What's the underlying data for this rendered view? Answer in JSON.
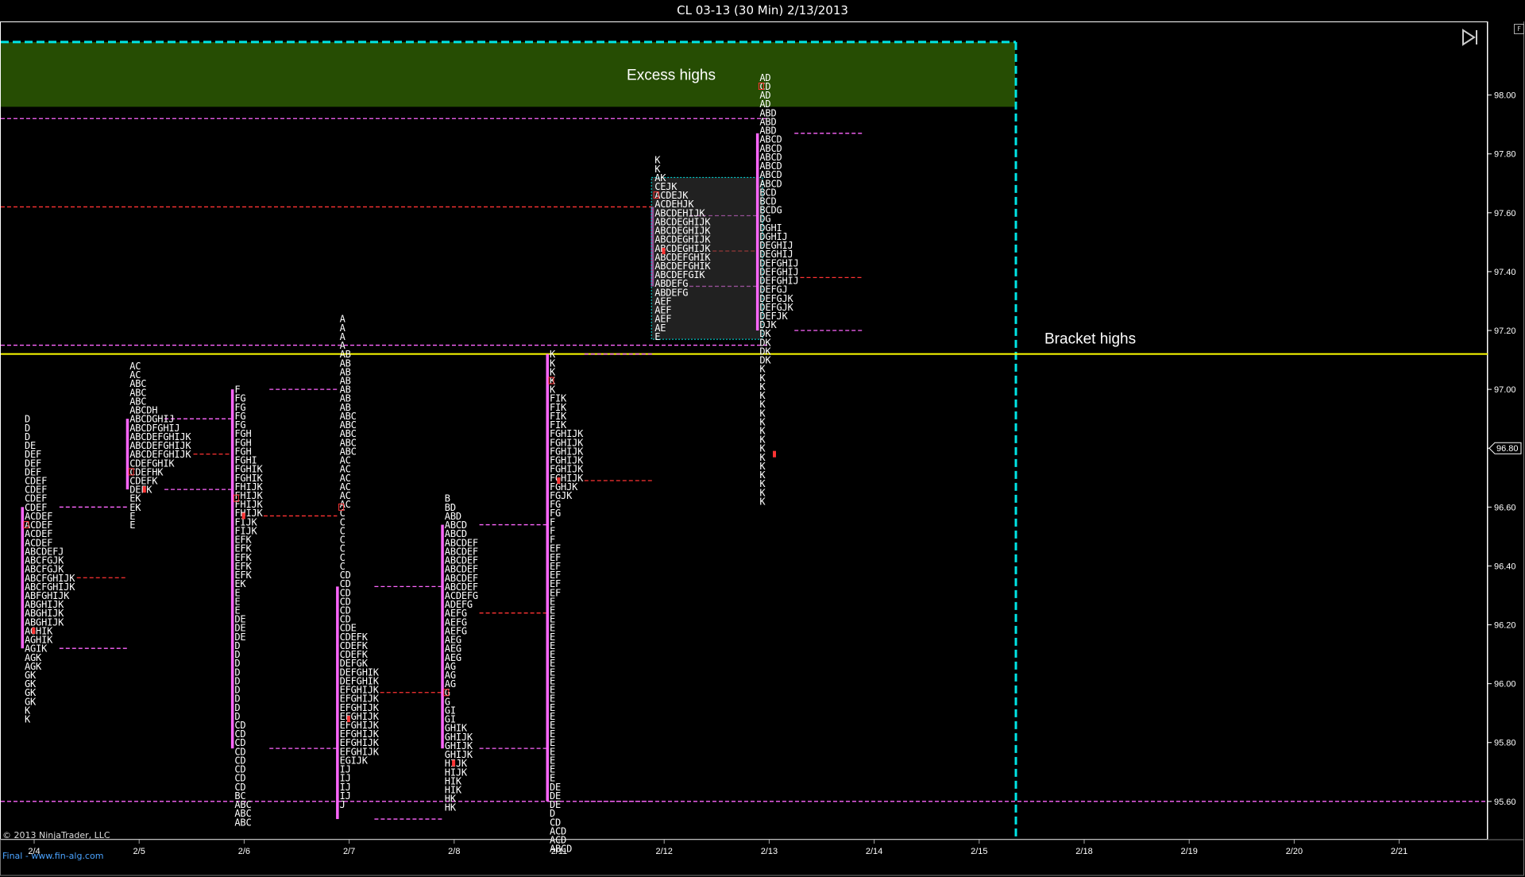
{
  "title": "CL 03-13 (30 Min)  2/13/2013",
  "copyright": "© 2013 NinjaTrader, LLC",
  "footer": "Final - www.fin-alg.com",
  "colors": {
    "background": "#000000",
    "axis": "#ffffff",
    "profile_text": "#ffffff",
    "open_marker": "#ff3333",
    "value_area_bar": "#ff66ff",
    "value_area_line": "#ff66ff",
    "poc_line": "#ff3333",
    "excess_zone": "#264d03",
    "bracket_line": "#ffff00",
    "session_divider": "#00e5e5",
    "footer_link": "#4aa3ff"
  },
  "chart_data": {
    "type": "market-profile",
    "x_labels": [
      "2/4",
      "2/5",
      "2/6",
      "2/7",
      "2/8",
      "2/11",
      "2/12",
      "2/13",
      "2/14",
      "2/15",
      "2/18",
      "2/19",
      "2/20",
      "2/21"
    ],
    "y_ticks": [
      "98.00",
      "97.80",
      "97.60",
      "97.40",
      "97.20",
      "97.00",
      "96.80",
      "96.60",
      "96.40",
      "96.20",
      "96.00",
      "95.80",
      "95.60"
    ],
    "ylim": [
      95.47,
      98.25
    ],
    "tick_size": 0.03,
    "current_price": "96.80",
    "annotations": {
      "excess_zone": {
        "label": "Excess highs",
        "y_low": 97.96,
        "y_high": 98.18
      },
      "bracket_line": {
        "label": "Bracket highs",
        "y": 97.12
      }
    },
    "profiles": [
      {
        "date": "2/4",
        "top": 96.9,
        "rows": [
          "D",
          "D",
          "D",
          "DE",
          "DEF",
          "DEF",
          "DEF",
          "CDEF",
          "CDEF",
          "CDEF",
          "CDEF",
          "ACDEF",
          "ACDEF",
          "ACDEF",
          "ACDEF",
          "ABCDEFJ",
          "ABCFGJK",
          "ABCFGJK",
          "ABCFGHIJK",
          "ABCFGHIJK",
          "ABFGHIJK",
          "ABGHIJK",
          "ABGHIJK",
          "ABGHIJK",
          "AGHIK",
          "AGHIK",
          "AGIK",
          "AGK",
          "AGK",
          "GK",
          "GK",
          "GK",
          "GK",
          "K",
          "K"
        ],
        "va_high": 96.6,
        "va_low": 96.12,
        "poc": 96.36,
        "vah_ext": 96.6,
        "val_ext": 96.12,
        "open_price": 96.54,
        "close_price": 96.18
      },
      {
        "date": "2/5",
        "top": 97.08,
        "rows": [
          "AC",
          "AC",
          "ABC",
          "ABC",
          "ABC",
          "ABCDH",
          "ABCDGHIJ",
          "ABCDFGHIJ",
          "ABCDEFGHIJK",
          "ABCDEFGHIJK",
          "ABCDEFGHIJK",
          "CDEFGHIK",
          "CDEFHK",
          "CDEFK",
          "DEFK",
          "EK",
          "EK",
          "E",
          "E"
        ],
        "va_high": 96.9,
        "va_low": 96.66,
        "poc": 96.78,
        "vah_ext": 96.9,
        "val_ext": 96.66,
        "open_price": 96.72,
        "close_price": 96.66
      },
      {
        "date": "2/6",
        "top": 97.0,
        "rows": [
          "F",
          "FG",
          "FG",
          "FG",
          "FG",
          "FGH",
          "FGH",
          "FGH",
          "FGHI",
          "FGHIK",
          "FGHIK",
          "FHIJK",
          "FHIJK",
          "FHIJK",
          "FHIJK",
          "FIJK",
          "FIJK",
          "EFK",
          "EFK",
          "EFK",
          "EFK",
          "EFK",
          "EK",
          "E",
          "E",
          "E",
          "DE",
          "DE",
          "DE",
          "D",
          "D",
          "D",
          "D",
          "D",
          "D",
          "D",
          "D",
          "D",
          "CD",
          "CD",
          "CD",
          "CD",
          "CD",
          "CD",
          "CD",
          "CD",
          "BC",
          "ABC",
          "ABC",
          "ABC"
        ],
        "va_high": 97.0,
        "va_low": 95.78,
        "poc": 96.57,
        "vah_ext": 97.0,
        "val_ext": 95.78,
        "open_price": 96.63,
        "close_price": 96.57
      },
      {
        "date": "2/7",
        "top": 97.24,
        "rows": [
          "A",
          "A",
          "A",
          "A",
          "AB",
          "AB",
          "AB",
          "AB",
          "AB",
          "AB",
          "AB",
          "ABC",
          "ABC",
          "ABC",
          "ABC",
          "ABC",
          "AC",
          "AC",
          "AC",
          "AC",
          "AC",
          "AC",
          "C",
          "C",
          "C",
          "C",
          "C",
          "C",
          "C",
          "CD",
          "CD",
          "CD",
          "CD",
          "CD",
          "CD",
          "CDE",
          "CDEFK",
          "CDEFK",
          "CDEFK",
          "DEFGK",
          "DEFGHIK",
          "DEFGHIK",
          "EFGHIJK",
          "EFGHIJK",
          "EFGHIJK",
          "EFGHIJK",
          "EFGHIJK",
          "EFGHIJK",
          "EFGHIJK",
          "EFGHIJK",
          "EGIJK",
          "IJ",
          "IJ",
          "IJ",
          "IJ",
          "J"
        ],
        "va_high": 96.33,
        "va_low": 95.54,
        "poc": 95.97,
        "vah_ext": 96.33,
        "val_ext": 95.54,
        "open_price": 96.6,
        "close_price": 95.88
      },
      {
        "date": "2/8",
        "top": 96.63,
        "rows": [
          "B",
          "BD",
          "ABD",
          "ABCD",
          "ABCD",
          "ABCDEF",
          "ABCDEF",
          "ABCDEF",
          "ABCDEF",
          "ABCDEF",
          "ABCDEF",
          "ACDEFG",
          "ADEFG",
          "AEFG",
          "AEFG",
          "AEFG",
          "AEG",
          "AEG",
          "AEG",
          "AG",
          "AG",
          "AG",
          "G",
          "G",
          "GI",
          "GI",
          "GHIK",
          "GHIJK",
          "GHIJK",
          "GHIJK",
          "HIJK",
          "HIJK",
          "HIK",
          "HIK",
          "HK",
          "HK"
        ],
        "va_high": 96.54,
        "va_low": 95.78,
        "poc": 96.24,
        "vah_ext": 96.54,
        "val_ext": 95.78,
        "open_price": 95.97,
        "close_price": 95.73
      },
      {
        "date": "2/11",
        "top": 97.12,
        "rows": [
          "K",
          "K",
          "K",
          "K",
          "K",
          "FIK",
          "FIK",
          "FIK",
          "FIK",
          "FGHIJK",
          "FGHIJK",
          "FGHIJK",
          "FGHIJK",
          "FGHIJK",
          "FGHIJK",
          "FGHJK",
          "FGJK",
          "FG",
          "FG",
          "F",
          "F",
          "F",
          "EF",
          "EF",
          "EF",
          "EF",
          "EF",
          "EF",
          "E",
          "E",
          "E",
          "E",
          "E",
          "E",
          "E",
          "E",
          "E",
          "E",
          "E",
          "E",
          "E",
          "E",
          "E",
          "E",
          "E",
          "E",
          "E",
          "E",
          "E",
          "DE",
          "DE",
          "DE",
          "D",
          "CD",
          "ACD",
          "ACD",
          "ABCD"
        ],
        "va_high": 97.12,
        "va_low": 95.6,
        "poc": 96.69,
        "vah_ext": 97.12,
        "val_ext": 95.6,
        "open_price": 97.03,
        "close_price": 96.69
      },
      {
        "date": "2/12",
        "top": 97.78,
        "rows": [
          "K",
          "K",
          "AK",
          "CEJK",
          "ACDEJK",
          "ACDEHJK",
          "ABCDEHIJK",
          "ABCDEGHIJK",
          "ABCDEGHIJK",
          "ABCDEGHIJK",
          "ABCDEGHIJK",
          "ABCDEFGHIK",
          "ABCDEFGHIK",
          "ABCDEFGIK",
          "ABDEFG",
          "ABDEFG",
          "AEF",
          "AEF",
          "AEF",
          "AE",
          "E"
        ],
        "va_high": 97.62,
        "va_low": 97.35,
        "poc": 97.47,
        "vah_ext": 97.59,
        "val_ext": 97.35,
        "open_price": 97.66,
        "close_price": 97.47,
        "box": [
          97.72,
          97.17
        ]
      },
      {
        "date": "2/13",
        "top": 98.06,
        "rows": [
          "AD",
          "CD",
          "AD",
          "AD",
          "ABD",
          "ABD",
          "ABD",
          "ABCD",
          "ABCD",
          "ABCD",
          "ABCD",
          "ABCD",
          "ABCD",
          "BCD",
          "BCD",
          "BCDG",
          "DG",
          "DGHI",
          "DGHIJ",
          "DEGHIJ",
          "DEGHIJ",
          "DEFGHIJ",
          "DEFGHIJ",
          "DEFGHIJ",
          "DEFGJ",
          "DEFGJK",
          "DEFGJK",
          "DEFJK",
          "DJK",
          "DK",
          "DK",
          "DK",
          "DK",
          "K",
          "K",
          "K",
          "K",
          "K",
          "K",
          "K",
          "K",
          "K",
          "K",
          "K",
          "K",
          "K",
          "K",
          "K",
          "K"
        ],
        "va_high": 97.87,
        "va_low": 97.2,
        "poc": 97.38,
        "vah_ext": 97.87,
        "val_ext": 97.2,
        "open_price": 98.03,
        "close_price": 96.78,
        "box": [
          97.72,
          97.17
        ]
      }
    ],
    "extended_lines": [
      {
        "y": 97.92,
        "style": "va"
      },
      {
        "y": 97.62,
        "style": "poc"
      },
      {
        "y": 97.15,
        "style": "va"
      }
    ]
  }
}
